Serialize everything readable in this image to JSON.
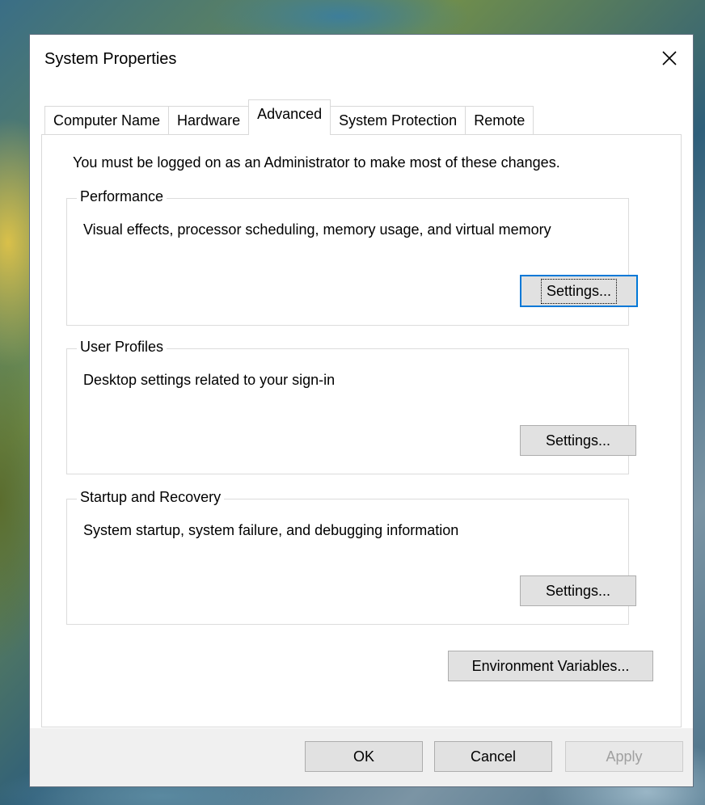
{
  "window": {
    "title": "System Properties",
    "close_icon": "close-icon"
  },
  "tabs": [
    {
      "label": "Computer Name",
      "active": false
    },
    {
      "label": "Hardware",
      "active": false
    },
    {
      "label": "Advanced",
      "active": true
    },
    {
      "label": "System Protection",
      "active": false
    },
    {
      "label": "Remote",
      "active": false
    }
  ],
  "admin_note": "You must be logged on as an Administrator to make most of these changes.",
  "groups": {
    "performance": {
      "legend": "Performance",
      "description": "Visual effects, processor scheduling, memory usage, and virtual memory",
      "button": "Settings..."
    },
    "user_profiles": {
      "legend": "User Profiles",
      "description": "Desktop settings related to your sign-in",
      "button": "Settings..."
    },
    "startup_recovery": {
      "legend": "Startup and Recovery",
      "description": "System startup, system failure, and debugging information",
      "button": "Settings..."
    }
  },
  "environment_button": "Environment Variables...",
  "footer": {
    "ok": "OK",
    "cancel": "Cancel",
    "apply": "Apply"
  },
  "colors": {
    "focus_accent": "#0078d7",
    "button_face": "#e1e1e1",
    "footer_bg": "#f0f0f0",
    "disabled_text": "#a0a0a0"
  }
}
